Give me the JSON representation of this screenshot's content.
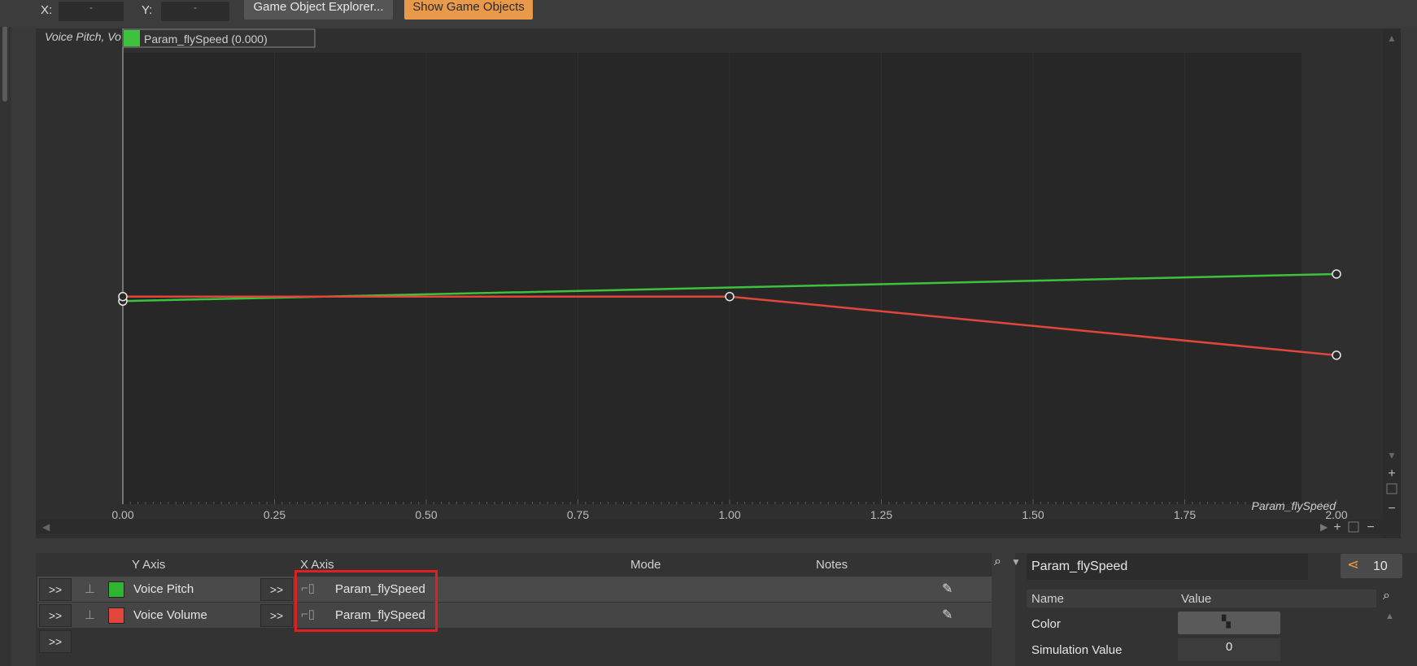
{
  "toolbar": {
    "x_label": "X:",
    "x_value": "-",
    "y_label": "Y:",
    "y_value": "-",
    "explorer_button": "Game Object Explorer...",
    "show_objects_button": "Show Game Objects"
  },
  "graph": {
    "y_axis_title": "Voice Pitch, Vo",
    "cursor_label": "Param_flySpeed (0.000)",
    "x_axis_title": "Param_flySpeed",
    "x_ticks": [
      "0.00",
      "0.25",
      "0.50",
      "0.75",
      "1.00",
      "1.25",
      "1.50",
      "1.75",
      "2.00"
    ],
    "colors": {
      "pitch": "#3cc23c",
      "volume": "#e0463a",
      "cursor": "#3cc23c"
    }
  },
  "chart_data": {
    "type": "line",
    "xlabel": "Param_flySpeed",
    "xlim": [
      0,
      2
    ],
    "series": [
      {
        "name": "Voice Pitch",
        "x": [
          0,
          2
        ],
        "y": [
          0.45,
          0.51
        ]
      },
      {
        "name": "Voice Volume",
        "x": [
          0,
          1,
          2
        ],
        "y": [
          0.46,
          0.46,
          0.33
        ]
      }
    ]
  },
  "table": {
    "headers": {
      "y_axis": "Y Axis",
      "x_axis": "X Axis",
      "mode": "Mode",
      "notes": "Notes"
    },
    "expand_label": ">>",
    "rows": [
      {
        "y_axis": "Voice Pitch",
        "color": "#2fb52f",
        "x_axis": "Param_flySpeed"
      },
      {
        "y_axis": "Voice Volume",
        "color": "#e0463a",
        "x_axis": "Param_flySpeed"
      }
    ]
  },
  "properties": {
    "title": "Param_flySpeed",
    "ref_count": "10",
    "col_name": "Name",
    "col_value": "Value",
    "rows": [
      {
        "name": "Color",
        "value": ""
      },
      {
        "name": "Simulation Value",
        "value": "0"
      }
    ]
  }
}
